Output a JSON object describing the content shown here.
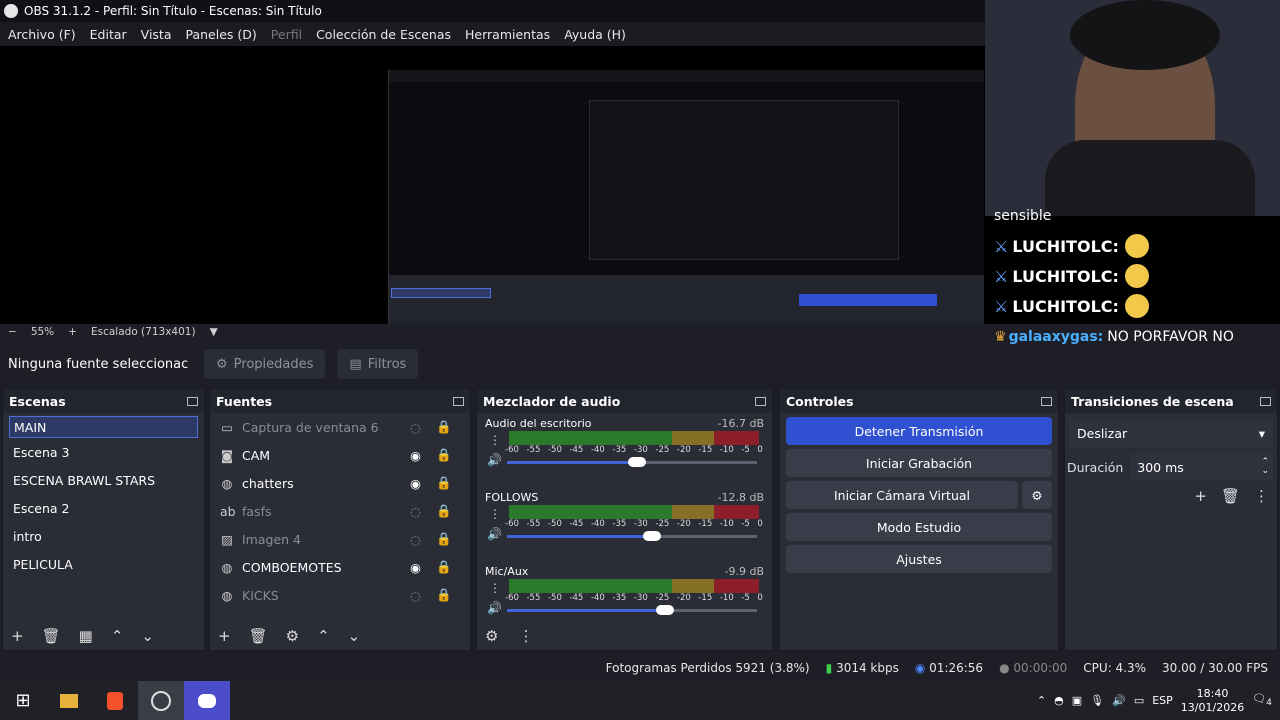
{
  "window": {
    "title": "OBS 31.1.2 - Perfil: Sin Título - Escenas: Sin Título"
  },
  "menu": [
    {
      "label": "Archivo (F)"
    },
    {
      "label": "Editar"
    },
    {
      "label": "Vista"
    },
    {
      "label": "Paneles (D)"
    },
    {
      "label": "Perfil"
    },
    {
      "label": "Colección de Escenas"
    },
    {
      "label": "Herramientas"
    },
    {
      "label": "Ayuda (H)"
    }
  ],
  "zoom": {
    "minus": "−",
    "value": "55%",
    "plus": "+",
    "scale": "Escalado (713x401)"
  },
  "chat": {
    "partial": "sensible",
    "messages": [
      {
        "user": "LUCHITOLC:"
      },
      {
        "user": "LUCHITOLC:"
      },
      {
        "user": "LUCHITOLC:"
      }
    ],
    "last": {
      "user": "galaaxygas:",
      "text": "NO PORFAVOR NO"
    }
  },
  "props": {
    "no_source": "Ninguna fuente seleccionac",
    "properties": "Propiedades",
    "filters": "Filtros"
  },
  "scenes": {
    "title": "Escenas",
    "items": [
      "MAIN",
      "Escena 3",
      "ESCENA BRAWL STARS",
      "Escena 2",
      "intro",
      "PELICULA"
    ]
  },
  "sources": {
    "title": "Fuentes",
    "items": [
      {
        "label": "Captura de ventana 6",
        "icon": "window-icon"
      },
      {
        "label": "CAM",
        "icon": "camera-icon"
      },
      {
        "label": "chatters",
        "icon": "browser-icon"
      },
      {
        "label": "fasfs",
        "icon": "text-icon"
      },
      {
        "label": "Imagen 4",
        "icon": "image-icon"
      },
      {
        "label": "COMBOEMOTES",
        "icon": "browser-icon"
      },
      {
        "label": "KICKS",
        "icon": "browser-icon"
      }
    ]
  },
  "mixer": {
    "title": "Mezclador de audio",
    "ticks": [
      "-60",
      "-55",
      "-50",
      "-45",
      "-40",
      "-35",
      "-30",
      "-25",
      "-20",
      "-15",
      "-10",
      "-5",
      "0"
    ],
    "channels": [
      {
        "name": "Audio del escritorio",
        "db": "-16.7 dB",
        "volume": 0.52
      },
      {
        "name": "FOLLOWS",
        "db": "-12.8 dB",
        "volume": 0.58
      },
      {
        "name": "Mic/Aux",
        "db": "-9.9 dB",
        "volume": 0.63
      }
    ]
  },
  "controls": {
    "title": "Controles",
    "stop_stream": "Detener Transmisión",
    "start_recording": "Iniciar Grabación",
    "virtual_cam": "Iniciar Cámara Virtual",
    "studio_mode": "Modo Estudio",
    "settings": "Ajustes"
  },
  "transitions": {
    "title": "Transiciones de escena",
    "selected": "Deslizar",
    "duration_label": "Duración",
    "duration_value": "300 ms"
  },
  "status": {
    "dropped": "Fotogramas Perdidos 5921 (3.8%)",
    "bitrate": "3014 kbps",
    "stream_time": "01:26:56",
    "rec_time": "00:00:00",
    "cpu": "CPU: 4.3%",
    "fps": "30.00 / 30.00 FPS"
  },
  "taskbar": {
    "lang": "ESP",
    "time": "18:40",
    "date": "13/01/2026",
    "notif": "4"
  }
}
